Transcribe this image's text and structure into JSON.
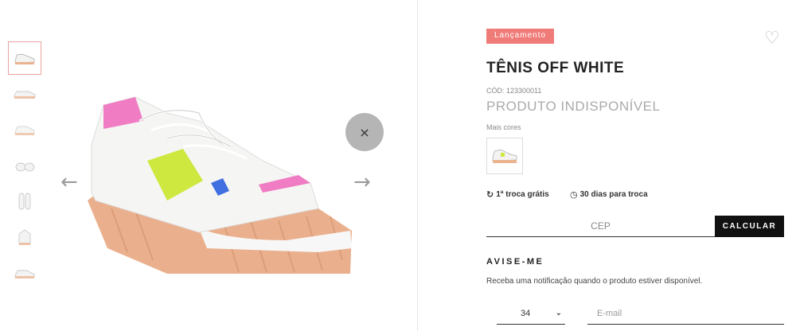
{
  "gallery": {
    "thumbnails": [
      "front-view",
      "side-view",
      "back-view",
      "sole-view",
      "top-view",
      "detail-view",
      "pair-view"
    ],
    "active_thumbnail": 0,
    "prev_arrow": "←",
    "next_arrow": "→",
    "close_glyph": "×"
  },
  "product": {
    "badge": "Lançamento",
    "title": "TÊNIS OFF WHITE",
    "code": "CÓD: 123300011",
    "availability": "PRODUTO INDISPONÍVEL",
    "more_colors_label": "Mais cores",
    "favorite_icon": "heart-outline-icon"
  },
  "perks": [
    {
      "icon": "swap-icon",
      "glyph": "↻",
      "label": "1ª troca grátis"
    },
    {
      "icon": "clock-icon",
      "glyph": "◷",
      "label": "30 dias para troca"
    }
  ],
  "shipping": {
    "cep_placeholder": "CEP",
    "calculate_label": "CALCULAR"
  },
  "notify": {
    "heading": "AVISE-ME",
    "description": "Receba uma notificação quando o produto estiver disponível.",
    "size_value": "34",
    "email_placeholder": "E-mail"
  },
  "colors": {
    "badge_bg": "#f07c79",
    "button_bg": "#111111",
    "muted_text": "#aaaaaa"
  }
}
